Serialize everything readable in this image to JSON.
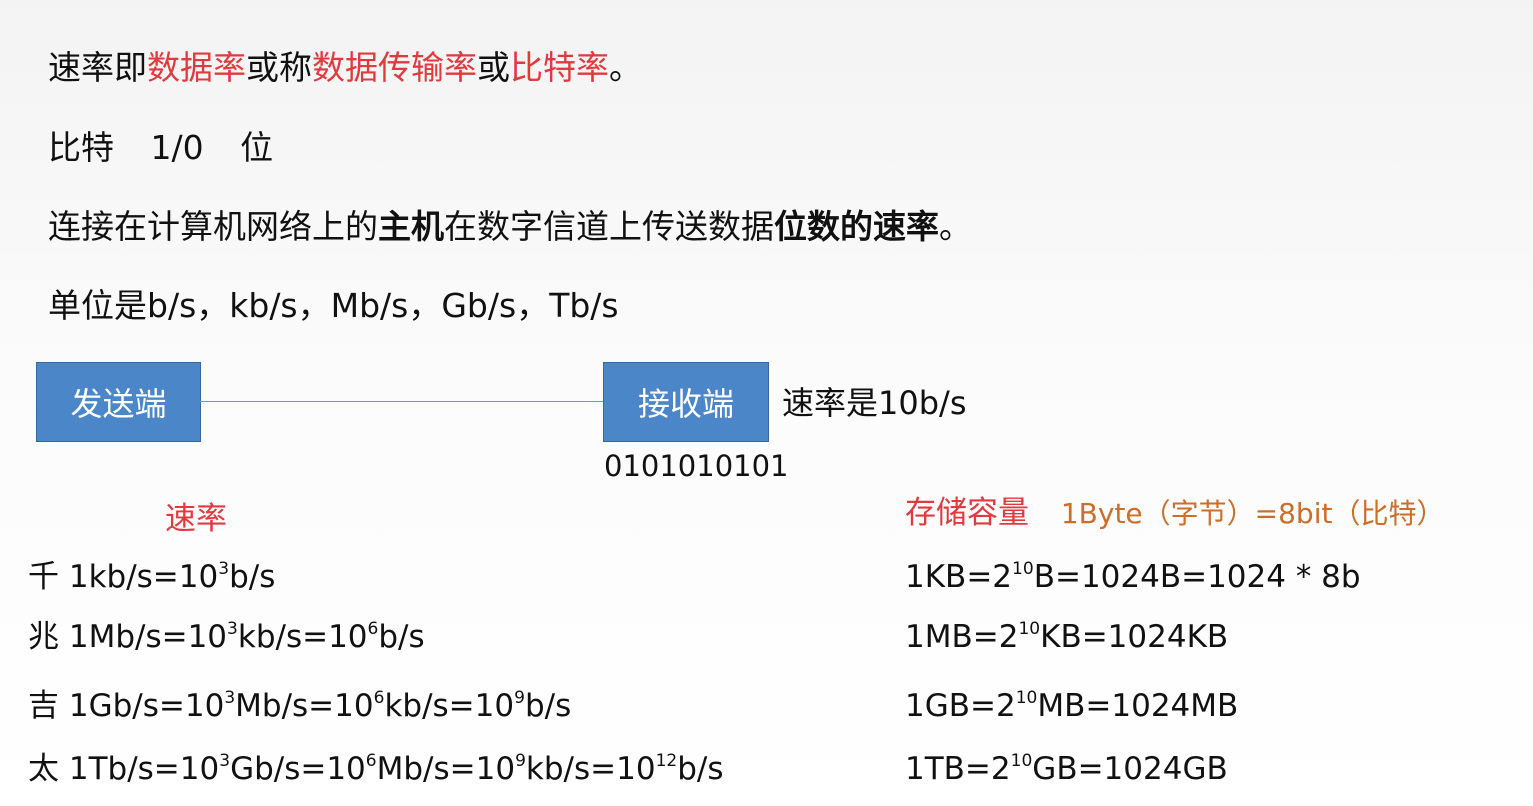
{
  "definition": {
    "p1": "速率即",
    "t1": "数据率",
    "p2": "或称",
    "t2": "数据传输率",
    "p3": "或",
    "t3": "比特率",
    "p4": "。"
  },
  "bit_line": {
    "word": "比特",
    "value": "1/0",
    "unit": "位"
  },
  "host_line": {
    "p1": "连接在计算机网络上的",
    "b1": "主机",
    "p2": "在数字信道上传送数据",
    "b2": "位数的速率",
    "p3": "。"
  },
  "units_line": {
    "prefix": "单位是",
    "units": "b/s，kb/s，Mb/s，Gb/s，Tb/s"
  },
  "diagram": {
    "sender": "发送端",
    "receiver": "接收端",
    "rate_note": "速率是10b/s",
    "bits": "0101010101"
  },
  "rate_section": {
    "heading": "速率",
    "rows": [
      {
        "prefix": "千",
        "a": "1kb/s=10",
        "e1": "3",
        "b": "b/s",
        "e2": "",
        "c": "",
        "e3": "",
        "d": "",
        "e4": "",
        "e": ""
      },
      {
        "prefix": "兆",
        "a": "1Mb/s=10",
        "e1": "3",
        "b": "kb/s=10",
        "e2": "6",
        "c": "b/s",
        "e3": "",
        "d": "",
        "e4": "",
        "e": ""
      },
      {
        "prefix": "吉",
        "a": "1Gb/s=10",
        "e1": "3",
        "b": "Mb/s=10",
        "e2": "6",
        "c": "kb/s=10",
        "e3": "9",
        "d": "b/s",
        "e4": "",
        "e": ""
      },
      {
        "prefix": "太",
        "a": "1Tb/s=10",
        "e1": "3",
        "b": "Gb/s=10",
        "e2": "6",
        "c": "Mb/s=10",
        "e3": "9",
        "d": "kb/s=10",
        "e4": "12",
        "e": "b/s"
      }
    ]
  },
  "storage_section": {
    "heading": "存储容量",
    "note": "1Byte（字节）=8bit（比特）",
    "rows": [
      {
        "a": "1KB=2",
        "exp": "10",
        "b": "B=1024B=1024 * 8b"
      },
      {
        "a": "1MB=2",
        "exp": "10",
        "b": "KB=1024KB"
      },
      {
        "a": "1GB=2",
        "exp": "10",
        "b": "MB=1024MB"
      },
      {
        "a": "1TB=2",
        "exp": "10",
        "b": "GB=1024GB"
      }
    ]
  }
}
